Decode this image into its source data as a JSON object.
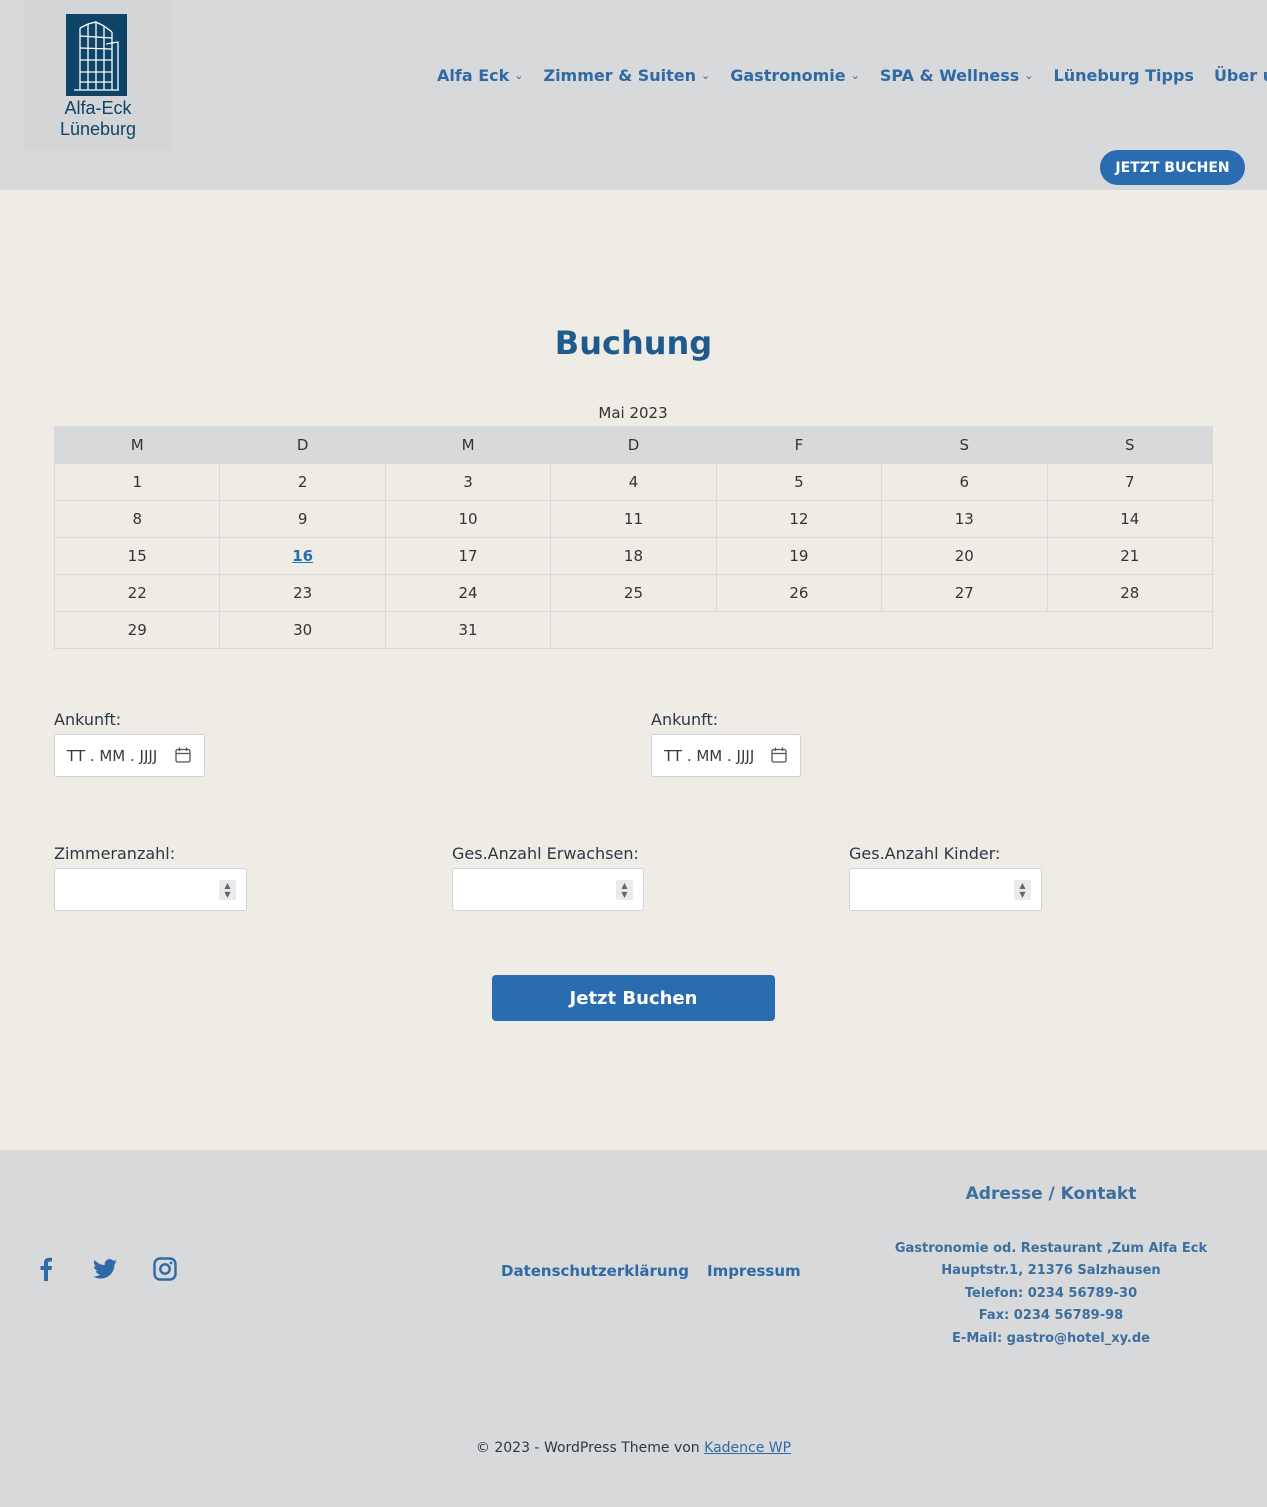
{
  "header": {
    "logo_line1": "Alfa-Eck",
    "logo_line2": "Lüneburg",
    "nav": [
      {
        "label": "Alfa Eck",
        "has_dropdown": true
      },
      {
        "label": "Zimmer & Suiten",
        "has_dropdown": true
      },
      {
        "label": "Gastronomie",
        "has_dropdown": true
      },
      {
        "label": "SPA & Wellness",
        "has_dropdown": true
      },
      {
        "label": "Lüneburg Tipps",
        "has_dropdown": false
      },
      {
        "label": "Über uns",
        "has_dropdown": true
      }
    ],
    "book_button": "JETZT BUCHEN"
  },
  "main": {
    "title": "Buchung",
    "calendar": {
      "caption": "Mai 2023",
      "weekdays": [
        "M",
        "D",
        "M",
        "D",
        "F",
        "S",
        "S"
      ],
      "weeks": [
        [
          "1",
          "2",
          "3",
          "4",
          "5",
          "6",
          "7"
        ],
        [
          "8",
          "9",
          "10",
          "11",
          "12",
          "13",
          "14"
        ],
        [
          "15",
          "16",
          "17",
          "18",
          "19",
          "20",
          "21"
        ],
        [
          "22",
          "23",
          "24",
          "25",
          "26",
          "27",
          "28"
        ],
        [
          "29",
          "30",
          "31"
        ]
      ],
      "highlighted_day": "16"
    },
    "arrival_label_1": "Ankunft:",
    "arrival_label_2": "Ankunft:",
    "date_placeholder": "TT . MM . JJJJ",
    "rooms_label": "Zimmeranzahl:",
    "adults_label": "Ges.Anzahl Erwachsen:",
    "children_label": "Ges.Anzahl Kinder:",
    "submit_button": "Jetzt Buchen"
  },
  "footer": {
    "social_icons": [
      "facebook-icon",
      "twitter-icon",
      "instagram-icon"
    ],
    "links": [
      "Datenschutzerklärung",
      "Impressum"
    ],
    "contact_title": "Adresse / Kontakt",
    "contact_lines": [
      "Gastronomie od. Restaurant ‚Zum Alfa Eck",
      "Hauptstr.1, 21376 Salzhausen",
      "Telefon: 0234 56789-30",
      "Fax: 0234 56789-98",
      "E-Mail: gastro@hotel_xy.de"
    ],
    "copyright_prefix": "© 2023 - WordPress Theme von",
    "copyright_link": "Kadence WP"
  },
  "colors": {
    "brand_blue": "#2a6cb0",
    "header_bg": "#d8d9db",
    "page_bg": "#eeece5",
    "logo_navy": "#0e4468"
  }
}
